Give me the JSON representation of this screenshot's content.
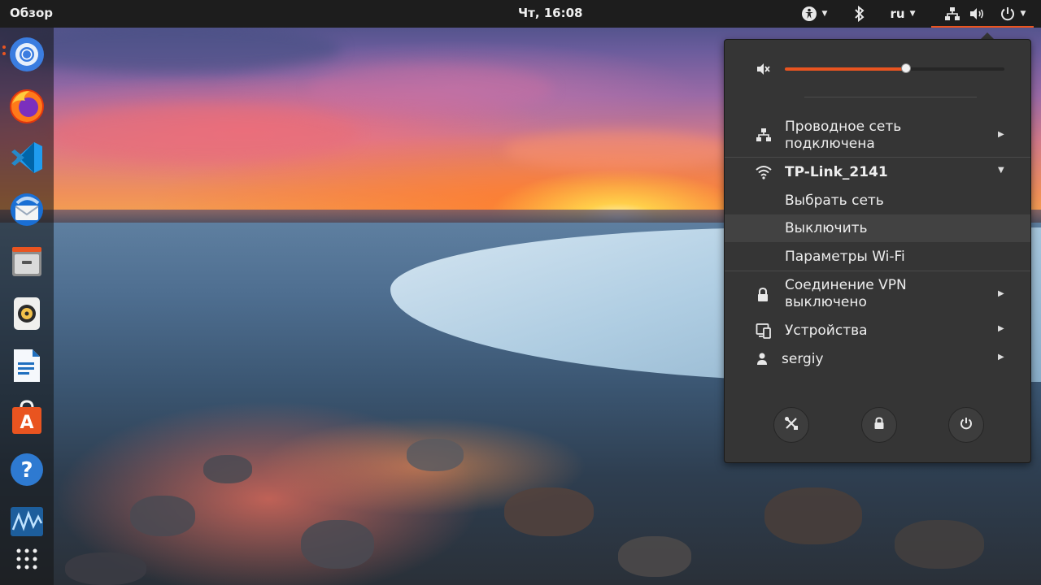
{
  "topbar": {
    "activities_label": "Обзор",
    "clock": "Чт, 16:08",
    "language": "ru",
    "icons": [
      "accessibility-icon",
      "bluetooth-icon",
      "network-wired-icon",
      "volume-icon",
      "power-icon"
    ],
    "accent_color": "#e95420"
  },
  "dock": {
    "items": [
      "chromium-icon",
      "firefox-icon",
      "vscode-icon",
      "thunderbird-icon",
      "files-icon",
      "rhythmbox-icon",
      "libreoffice-writer-icon",
      "software-center-icon",
      "help-icon",
      "system-monitor-icon",
      "show-apps-icon"
    ]
  },
  "system_menu": {
    "volume": {
      "level": 0.55,
      "muted_icon": "speaker-muted-icon"
    },
    "wired": {
      "label_line1": "Проводное сеть",
      "label_line2": "подключена"
    },
    "wifi": {
      "network_name": "TP-Link_2141",
      "submenu": [
        "Выбрать сеть",
        "Выключить",
        "Параметры Wi-Fi"
      ]
    },
    "vpn": {
      "label_line1": "Соединение VPN",
      "label_line2": "выключено"
    },
    "devices_label": "Устройства",
    "user_label": "sergiy",
    "bottom_buttons": [
      "settings-button",
      "lock-button",
      "power-off-button"
    ]
  }
}
